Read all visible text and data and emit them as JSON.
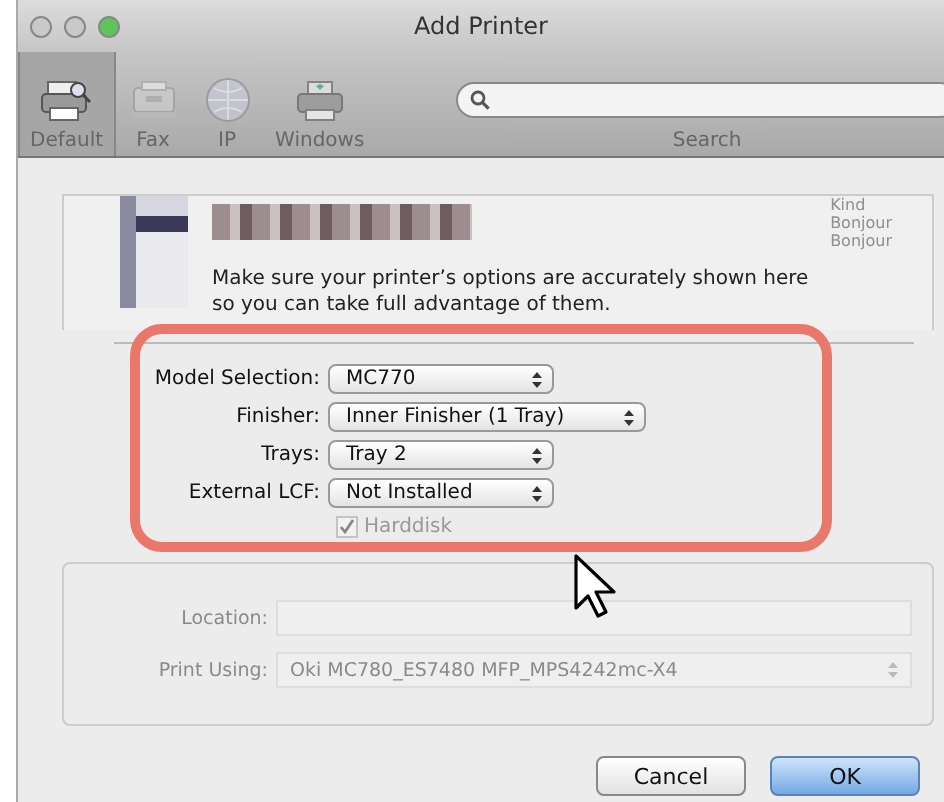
{
  "window": {
    "title": "Add Printer",
    "controls": [
      {
        "color": "#c9c9c9"
      },
      {
        "color": "#c9c9c9"
      },
      {
        "color": "#5fc45a"
      }
    ]
  },
  "toolbar": {
    "items": [
      {
        "label": "Default",
        "kind": "default",
        "selected": true
      },
      {
        "label": "Fax",
        "kind": "fax",
        "selected": false
      },
      {
        "label": "IP",
        "kind": "ip",
        "selected": false
      },
      {
        "label": "Windows",
        "kind": "windows",
        "selected": false
      }
    ],
    "search": {
      "label": "Search"
    }
  },
  "printer_list": {
    "kind_header": "Kind",
    "kinds": [
      "Bonjour",
      "Bonjour"
    ]
  },
  "sheet": {
    "message": "Make sure your printer’s options are accurately shown here so you can take full advantage of them.",
    "options": [
      {
        "kind": "popup",
        "label": "Model Selection:",
        "value": "MC770"
      },
      {
        "kind": "popup",
        "label": "Finisher:",
        "value": "Inner Finisher (1 Tray)"
      },
      {
        "kind": "popup",
        "label": "Trays:",
        "value": "Tray 2"
      },
      {
        "kind": "popup",
        "label": "External LCF:",
        "value": "Not Installed"
      },
      {
        "kind": "checkbox",
        "label": "Harddisk",
        "checked": true,
        "disabled": true
      }
    ]
  },
  "details": [
    {
      "kind": "field",
      "label": "Location:"
    },
    {
      "kind": "popup",
      "label": "Print Using:",
      "value": "Oki MC780_ES7480 MFP_MPS4242mc-X4"
    }
  ],
  "buttons": [
    {
      "label": "Cancel",
      "default": false
    },
    {
      "label": "OK",
      "default": true
    }
  ]
}
